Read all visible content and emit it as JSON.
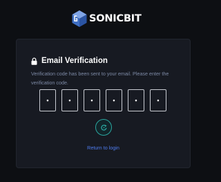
{
  "brand": {
    "name": "SONICBIT",
    "logo_icon": "sonicbit-cube-logo-icon",
    "logo_color": "#4b7bd1"
  },
  "verification": {
    "lock_icon": "lock-icon",
    "title": "Email Verification",
    "description": "Verification code has been sent to your email. Please enter the verification code.",
    "code_digits": [
      "•",
      "•",
      "•",
      "•",
      "•",
      "•"
    ],
    "resend_icon": "refresh-icon",
    "return_link": "Return to login"
  },
  "colors": {
    "background": "#0d0f13",
    "card": "#171a22",
    "muted_text": "#7d8aa6",
    "accent_teal": "#2aa7a0",
    "link_blue": "#4f7df0"
  }
}
